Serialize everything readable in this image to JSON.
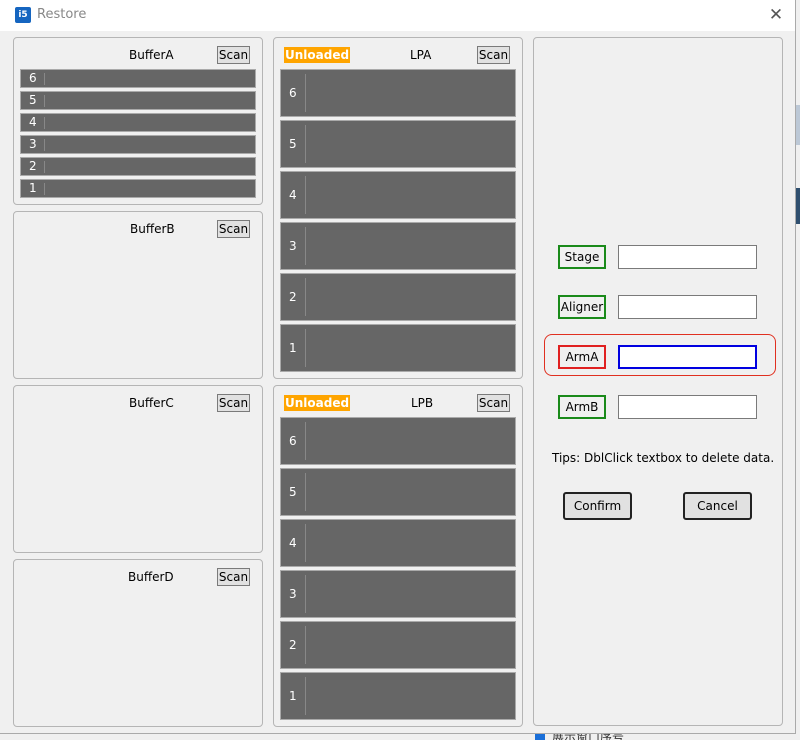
{
  "window": {
    "title": "Restore",
    "icon": "app-icon",
    "icon_glyph": "i5",
    "close_glyph": "✕"
  },
  "buffers": [
    {
      "title": "BufferA",
      "scan_label": "Scan",
      "slots": [
        "6",
        "5",
        "4",
        "3",
        "2",
        "1"
      ]
    },
    {
      "title": "BufferB",
      "scan_label": "Scan",
      "slots": []
    },
    {
      "title": "BufferC",
      "scan_label": "Scan",
      "slots": []
    },
    {
      "title": "BufferD",
      "scan_label": "Scan",
      "slots": []
    }
  ],
  "load_ports": [
    {
      "title": "LPA",
      "status": "Unloaded",
      "scan_label": "Scan",
      "slots": [
        "6",
        "5",
        "4",
        "3",
        "2",
        "1"
      ]
    },
    {
      "title": "LPB",
      "status": "Unloaded",
      "scan_label": "Scan",
      "slots": [
        "6",
        "5",
        "4",
        "3",
        "2",
        "1"
      ]
    }
  ],
  "fields": [
    {
      "label": "Stage",
      "value": ""
    },
    {
      "label": "Aligner",
      "value": ""
    },
    {
      "label": "ArmA",
      "value": ""
    },
    {
      "label": "ArmB",
      "value": ""
    }
  ],
  "tips": "Tips: DblClick textbox to delete data.",
  "buttons": {
    "confirm": "Confirm",
    "cancel": "Cancel"
  },
  "background": {
    "checkbox_label": "展示窗口序号"
  },
  "colors": {
    "unloaded_badge": "#ffa500",
    "slot_fill": "#666666",
    "label_border_ok": "#1a8a1a",
    "label_border_selected": "#e02020",
    "active_input_border": "#0000e0"
  }
}
